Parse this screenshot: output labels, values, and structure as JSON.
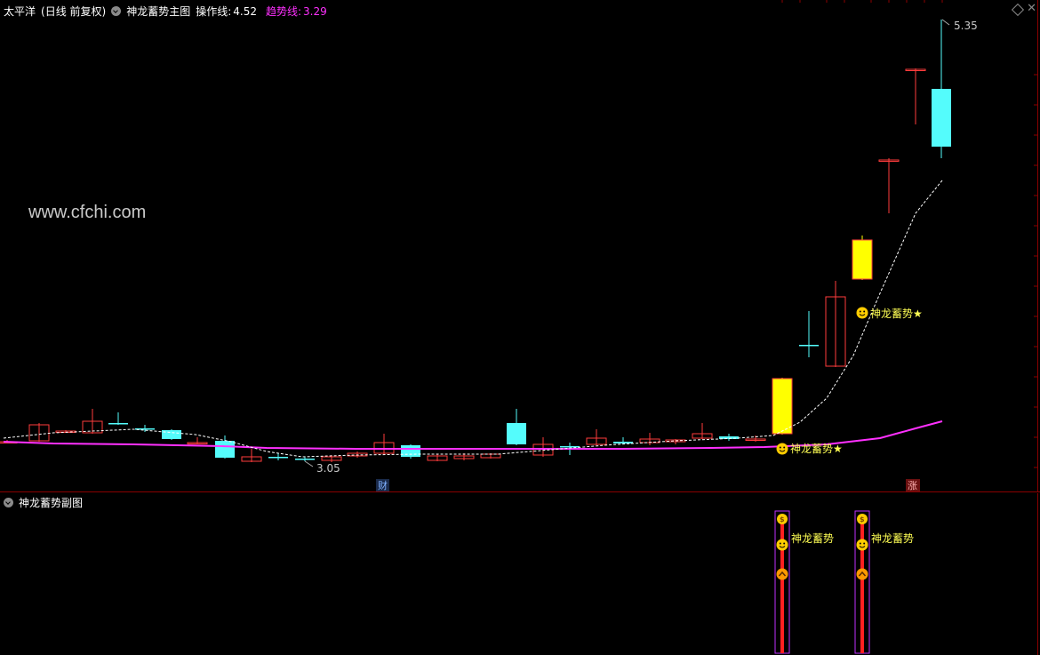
{
  "header": {
    "stock_name": "太平洋",
    "period": "(日线 前复权)",
    "indicator_main": "神龙蓄势主图",
    "op_line_label": "操作线:",
    "op_line_value": "4.52",
    "trend_line_label": "趋势线:",
    "trend_line_value": "3.29"
  },
  "watermark": "www.cfchi.com",
  "price_labels": {
    "high": "5.35",
    "low": "3.05"
  },
  "signals": {
    "main_label": "神龙蓄势★",
    "sub_label": "神龙蓄势"
  },
  "markers": {
    "cai": "财",
    "zhang": "涨"
  },
  "sub_panel": {
    "title": "神龙蓄势副图"
  },
  "colors": {
    "background": "#000000",
    "up_candle": "#ff3c3c",
    "down_candle": "#54fcfc",
    "signal_candle": "#ffff00",
    "trend_line": "#ff30ff",
    "op_line": "#ffffff",
    "signal_text": "#ffff54",
    "header_text": "#ffffff",
    "trend_text": "#ff30ff"
  },
  "icons": [
    "settings-circle-icon",
    "smiley-icon",
    "money-bag-icon",
    "up-chevron-icon",
    "diamond-icon",
    "close-icon"
  ]
}
